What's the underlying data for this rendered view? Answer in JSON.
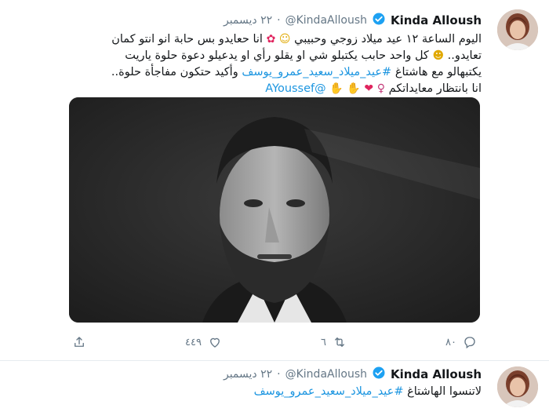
{
  "tweets": [
    {
      "author": {
        "display_name": "Kinda Alloush",
        "handle": "@KindaAlloush",
        "separator": "·",
        "date": "٢٢ ديسمبر"
      },
      "text": {
        "line1_a": "اليوم الساعة ١٢ عيد ميلاد زوجي وحبيبي",
        "line1_b": "انا حعايدو بس حابة انو انتو كمان",
        "line2_a": "تعايدو..",
        "line2_b": "كل واحد حابب يكتبلو شي او يقلو رأي او يدعيلو دعوة حلوة ياريت",
        "line3_a": "يكتبهالو مع هاشتاغ",
        "hashtag": "#عيد_ميلاد_سعيد_عمرو_يوسف",
        "line3_b": "وأكيد حتكون مفاجأة حلوة..",
        "line4_a": "انا بانتظار معايداتكم",
        "mention": "@AYoussef"
      },
      "actions": {
        "reply_count": "",
        "retweet_count": "٦",
        "like_count": "٤٤٩",
        "share_label": "",
        "views_count": "٨٠"
      }
    },
    {
      "author": {
        "display_name": "Kinda Alloush",
        "handle": "@KindaAlloush",
        "separator": "·",
        "date": "٢٢ ديسمبر"
      },
      "text": {
        "line1_a": "لاتنسوا الهاشتاغ",
        "hashtag": "#عيد_ميلاد_سعيد_عمرو_يوسف"
      }
    }
  ],
  "colors": {
    "link": "#1b95e0",
    "muted": "#657786",
    "verified": "#1da1f2"
  }
}
